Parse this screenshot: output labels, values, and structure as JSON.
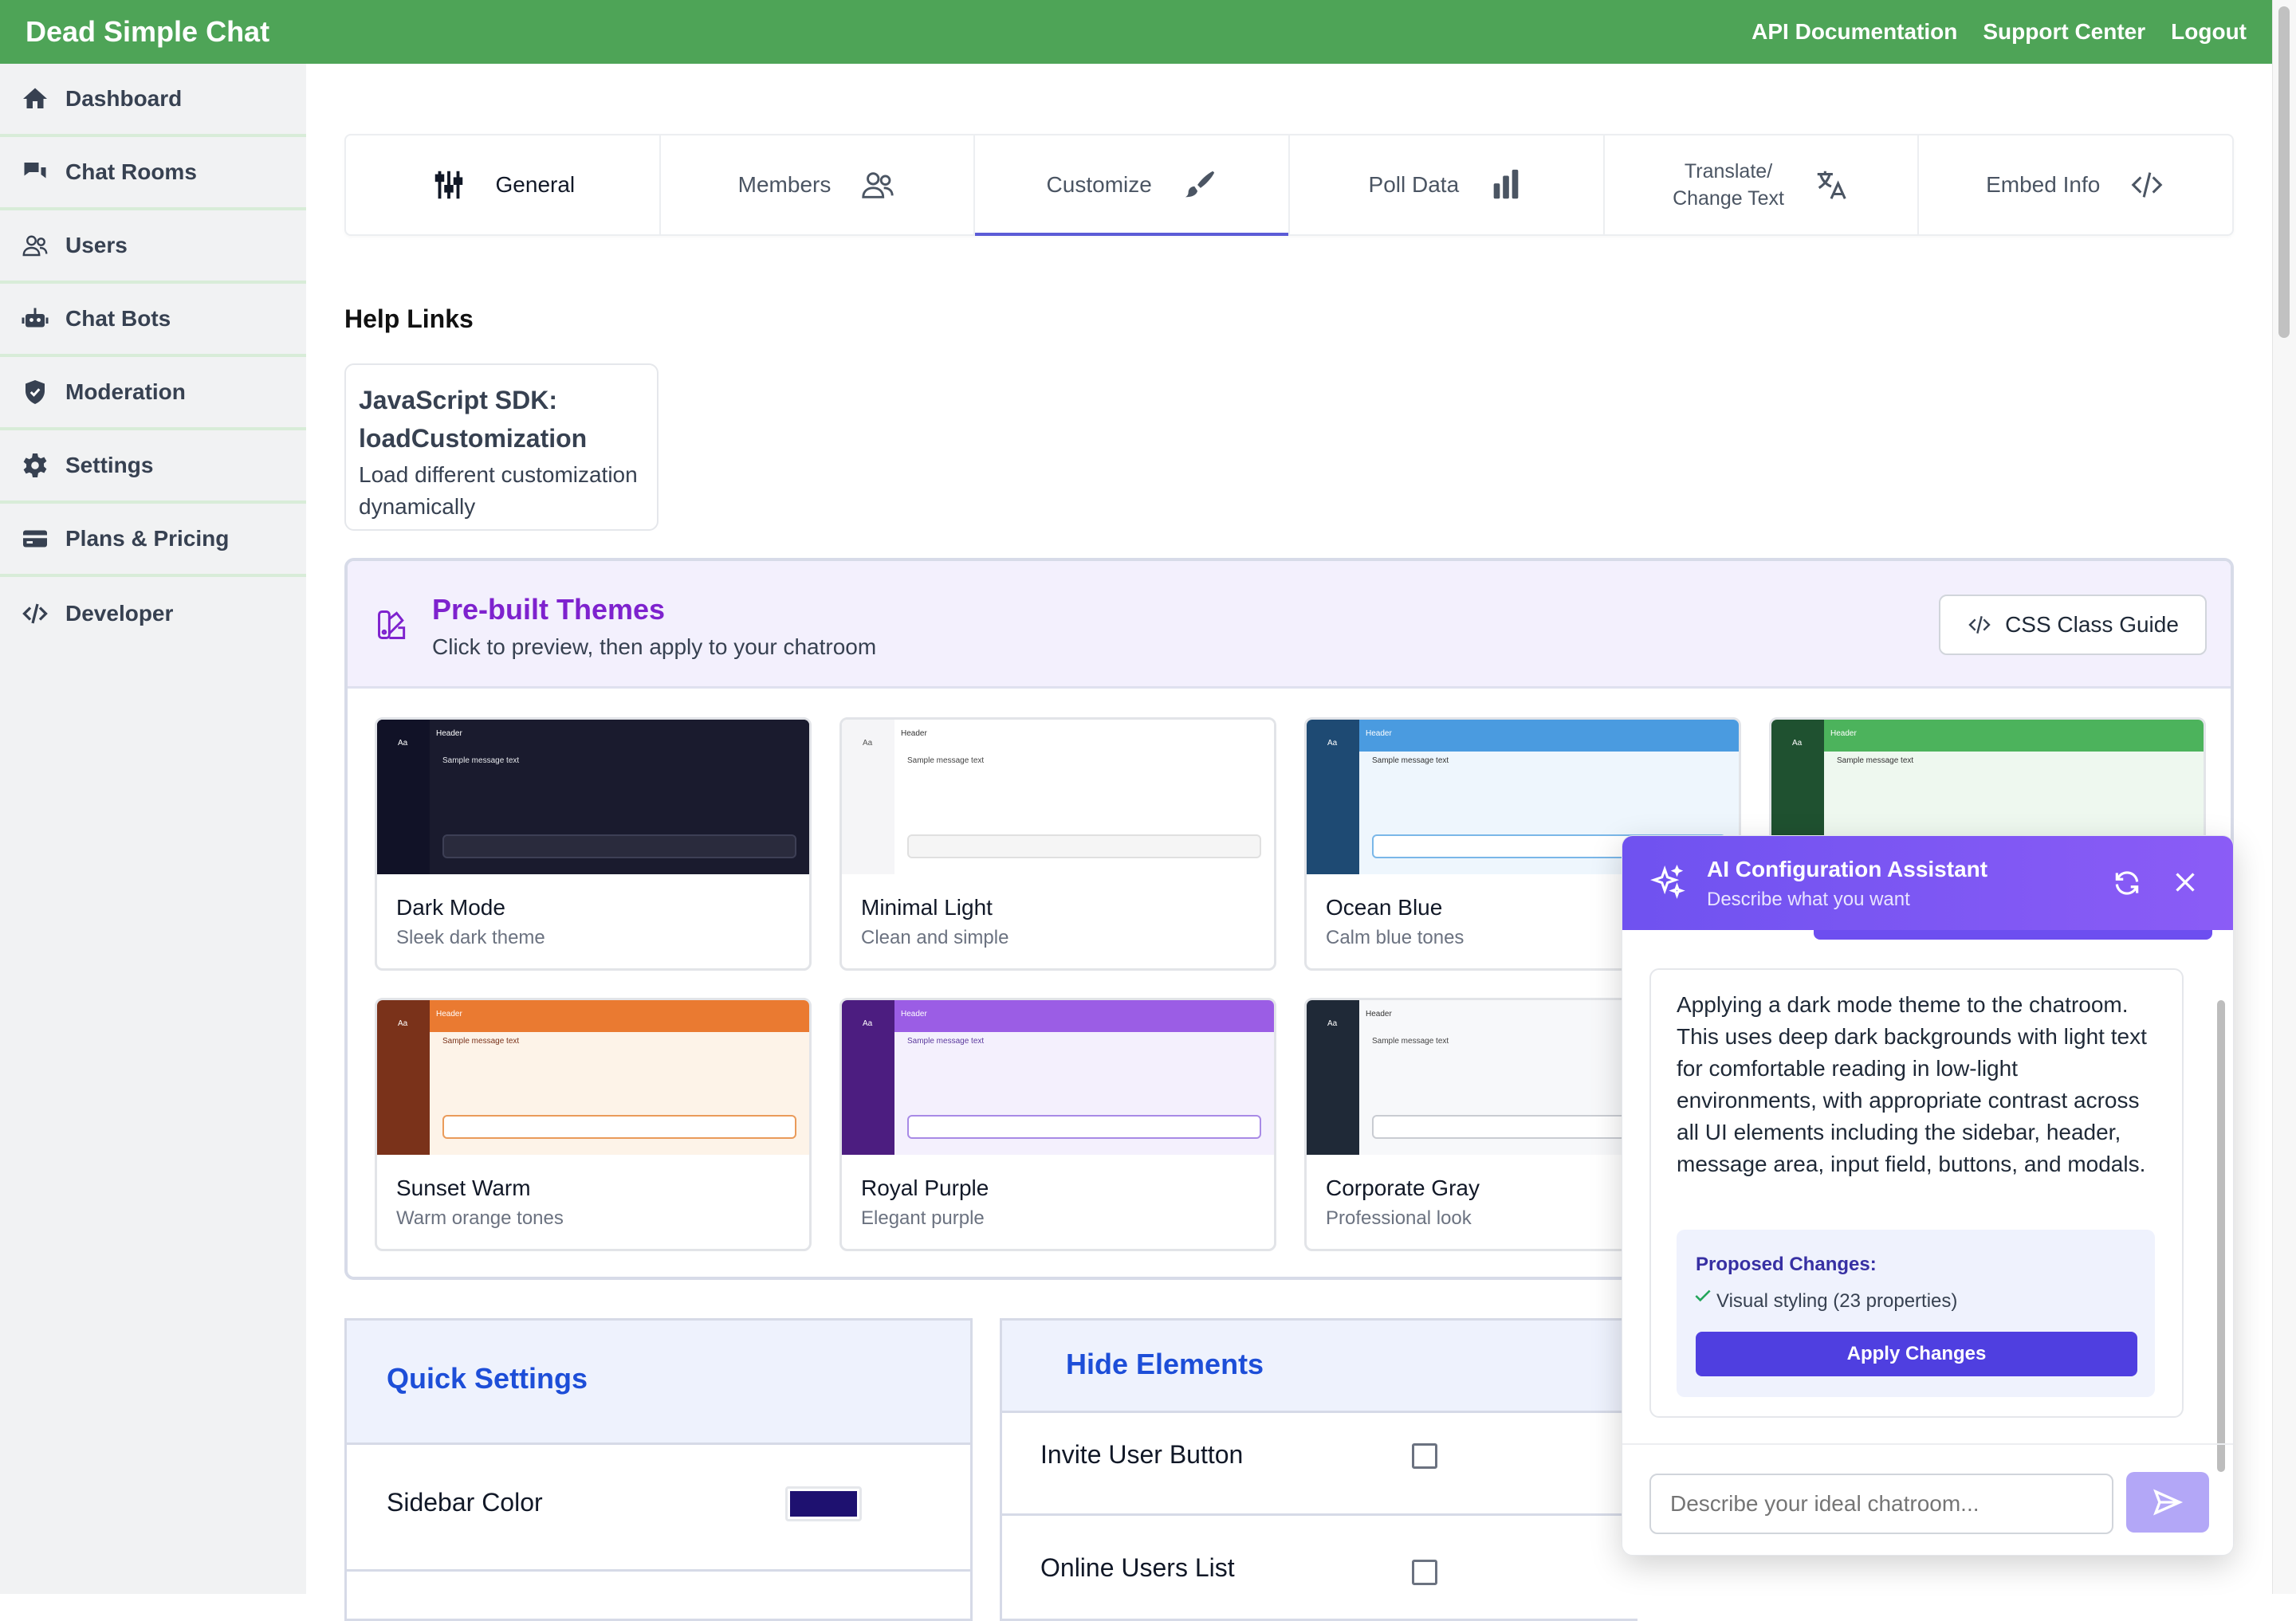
{
  "app": {
    "title": "Dead Simple Chat",
    "top_links": [
      "API Documentation",
      "Support Center",
      "Logout"
    ]
  },
  "sidebar": {
    "items": [
      {
        "label": "Dashboard",
        "icon": "home-icon"
      },
      {
        "label": "Chat Rooms",
        "icon": "chat-bubbles-icon"
      },
      {
        "label": "Users",
        "icon": "users-icon"
      },
      {
        "label": "Chat Bots",
        "icon": "robot-icon"
      },
      {
        "label": "Moderation",
        "icon": "shield-icon"
      },
      {
        "label": "Settings",
        "icon": "gear-icon"
      },
      {
        "label": "Plans & Pricing",
        "icon": "credit-card-icon"
      },
      {
        "label": "Developer",
        "icon": "code-icon"
      }
    ]
  },
  "tabs": {
    "items": [
      {
        "label": "General",
        "icon": "sliders-icon"
      },
      {
        "label": "Members",
        "icon": "users-icon"
      },
      {
        "label": "Customize",
        "icon": "paintbrush-icon",
        "selected": true
      },
      {
        "label": "Poll Data",
        "icon": "bar-chart-icon"
      },
      {
        "label_line1": "Translate/",
        "label_line2": "Change Text",
        "icon": "translate-icon"
      },
      {
        "label": "Embed Info",
        "icon": "code-icon"
      }
    ]
  },
  "help": {
    "title": "Help Links",
    "card_title": "JavaScript SDK: loadCustomization",
    "card_desc": "Load different customization dynamically"
  },
  "themes": {
    "title": "Pre-built Themes",
    "subtitle": "Click to preview, then apply to your chatroom",
    "css_guide_label": "CSS Class Guide",
    "preview_text": {
      "aa": "Aa",
      "header": "Header",
      "message": "Sample message text"
    },
    "items": [
      {
        "name": "Dark Mode",
        "desc": "Sleek dark theme"
      },
      {
        "name": "Minimal Light",
        "desc": "Clean and simple"
      },
      {
        "name": "Ocean Blue",
        "desc": "Calm blue tones"
      },
      {
        "name": "",
        "desc": ""
      },
      {
        "name": "Sunset Warm",
        "desc": "Warm orange tones"
      },
      {
        "name": "Royal Purple",
        "desc": "Elegant purple"
      },
      {
        "name": "Corporate Gray",
        "desc": "Professional look"
      }
    ]
  },
  "quick_settings": {
    "title": "Quick Settings",
    "sidebar_color_label": "Sidebar Color",
    "sidebar_color": "#1e1170"
  },
  "hide_elements": {
    "title": "Hide Elements",
    "items": [
      {
        "label": "Invite User Button",
        "checked": false
      },
      {
        "label": "Online Users List",
        "checked": false
      }
    ]
  },
  "ai_assistant": {
    "title": "AI Configuration Assistant",
    "subtitle": "Describe what you want",
    "message": "Applying a dark mode theme to the chatroom. This uses deep dark backgrounds with light text for comfortable reading in low-light environments, with appropriate contrast across all UI elements including the sidebar, header, message area, input field, buttons, and modals.",
    "proposed_title": "Proposed Changes:",
    "proposed_item": "Visual styling (23 properties)",
    "apply_label": "Apply Changes",
    "input_placeholder": "Describe your ideal chatroom..."
  },
  "colors": {
    "brand_green": "#4ea457",
    "accent_purple": "#7e22ce",
    "ai_header": "#6f52f0",
    "apply_button": "#4f3fe0"
  }
}
